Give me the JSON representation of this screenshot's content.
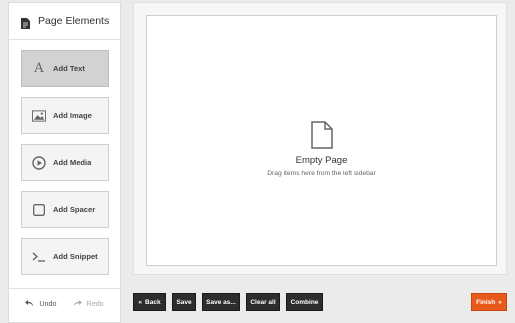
{
  "sidebar": {
    "title": "Page Elements",
    "tools": [
      {
        "label": "Add Text",
        "icon": "text-icon",
        "active": true
      },
      {
        "label": "Add Image",
        "icon": "image-icon",
        "active": false
      },
      {
        "label": "Add Media",
        "icon": "play-icon",
        "active": false
      },
      {
        "label": "Add Spacer",
        "icon": "square-icon",
        "active": false
      },
      {
        "label": "Add Snippet",
        "icon": "terminal-icon",
        "active": false
      }
    ],
    "undo_label": "Undo",
    "redo_label": "Redo"
  },
  "canvas": {
    "empty_title": "Empty Page",
    "empty_hint": "Drag items here from the left sidebar"
  },
  "toolbar": {
    "back_label": "Back",
    "save_label": "Save",
    "save_as_label": "Save as...",
    "clear_all_label": "Clear all",
    "combine_label": "Combine",
    "finish_label": "Finish"
  },
  "colors": {
    "accent": "#e8591c",
    "dark_button": "#2d2d2d"
  }
}
